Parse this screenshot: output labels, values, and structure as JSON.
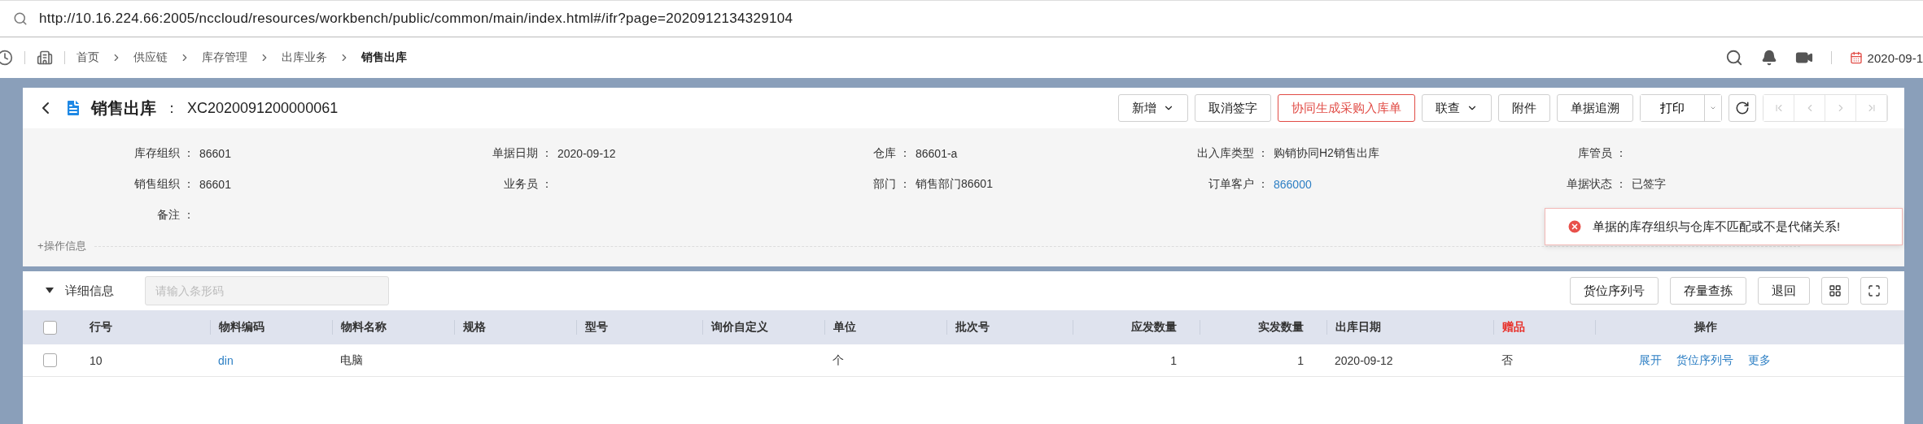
{
  "address_bar": {
    "url": "http://10.16.224.66:2005/nccloud/resources/workbench/public/common/main/index.html#/ifr?page=2020912134329104"
  },
  "breadcrumb": [
    {
      "label": "首页",
      "current": false
    },
    {
      "label": "供应链",
      "current": false
    },
    {
      "label": "库存管理",
      "current": false
    },
    {
      "label": "出库业务",
      "current": false
    },
    {
      "label": "销售出库",
      "current": true
    }
  ],
  "top_right": {
    "date": "2020-09-1"
  },
  "header": {
    "title": "销售出库",
    "separator": "：",
    "code": "XC2020091200000061"
  },
  "toolbar": [
    {
      "label": "新增",
      "kind": "dropdown"
    },
    {
      "label": "取消签字",
      "kind": "plain"
    },
    {
      "label": "协同生成采购入库单",
      "kind": "danger"
    },
    {
      "label": "联查",
      "kind": "dropdown"
    },
    {
      "label": "附件",
      "kind": "plain"
    },
    {
      "label": "单据追溯",
      "kind": "plain"
    },
    {
      "label": "打印",
      "kind": "split"
    }
  ],
  "form": {
    "fields": [
      {
        "label": "库存组织 ：",
        "value": "86601"
      },
      {
        "label": "单据日期 ：",
        "value": "2020-09-12"
      },
      {
        "label": "仓库 ：",
        "value": "86601-a"
      },
      {
        "label": "出入库类型 ：",
        "value": "购销协同H2销售出库"
      },
      {
        "label": "库管员 ："
      },
      {
        "label": "销售组织 ：",
        "value": "86601"
      },
      {
        "label": "业务员 ："
      },
      {
        "label": "部门 ：",
        "value": "销售部门86601"
      },
      {
        "label": "订单客户 ：",
        "value": "866000",
        "kind": "link"
      },
      {
        "label": "单据状态 ：",
        "value": "已签字"
      },
      {
        "label": "备注 ："
      }
    ],
    "operation_info": "+操作信息"
  },
  "toast": {
    "message": "单据的库存组织与仓库不匹配或不是代储关系!"
  },
  "detail": {
    "title": "详细信息",
    "expanded": true,
    "barcode_placeholder": "请输入条形码",
    "buttons": [
      "货位序列号",
      "存量查拣",
      "退回"
    ]
  },
  "table": {
    "header_checked": false,
    "columns": [
      {
        "label": "行号",
        "kind": "text",
        "required": false
      },
      {
        "label": "物料编码",
        "kind": "text",
        "required": false
      },
      {
        "label": "物料名称",
        "kind": "text",
        "required": false
      },
      {
        "label": "规格",
        "kind": "text",
        "required": false
      },
      {
        "label": "型号",
        "kind": "text",
        "required": false
      },
      {
        "label": "询价自定义",
        "kind": "text",
        "required": false
      },
      {
        "label": "单位",
        "kind": "text",
        "required": false
      },
      {
        "label": "批次号",
        "kind": "text",
        "required": false
      },
      {
        "label": "应发数量",
        "kind": "number",
        "required": false
      },
      {
        "label": "实发数量",
        "kind": "number",
        "required": false
      },
      {
        "label": "出库日期",
        "kind": "text",
        "required": false
      },
      {
        "label": "赠品",
        "kind": "text",
        "required": true
      },
      {
        "label": "操作",
        "kind": "actions",
        "required": false
      }
    ],
    "rows": [
      {
        "checked": false,
        "cells": [
          {
            "text": "10"
          },
          {
            "text": "din",
            "kind": "link"
          },
          {
            "text": "电脑"
          },
          {
            "text": ""
          },
          {
            "text": ""
          },
          {
            "text": ""
          },
          {
            "text": "个"
          },
          {
            "text": ""
          },
          {
            "text": "1"
          },
          {
            "text": "1"
          },
          {
            "text": "2020-09-12"
          },
          {
            "text": "否"
          }
        ],
        "actions": [
          "展开",
          "货位序列号",
          "更多"
        ]
      }
    ]
  }
}
